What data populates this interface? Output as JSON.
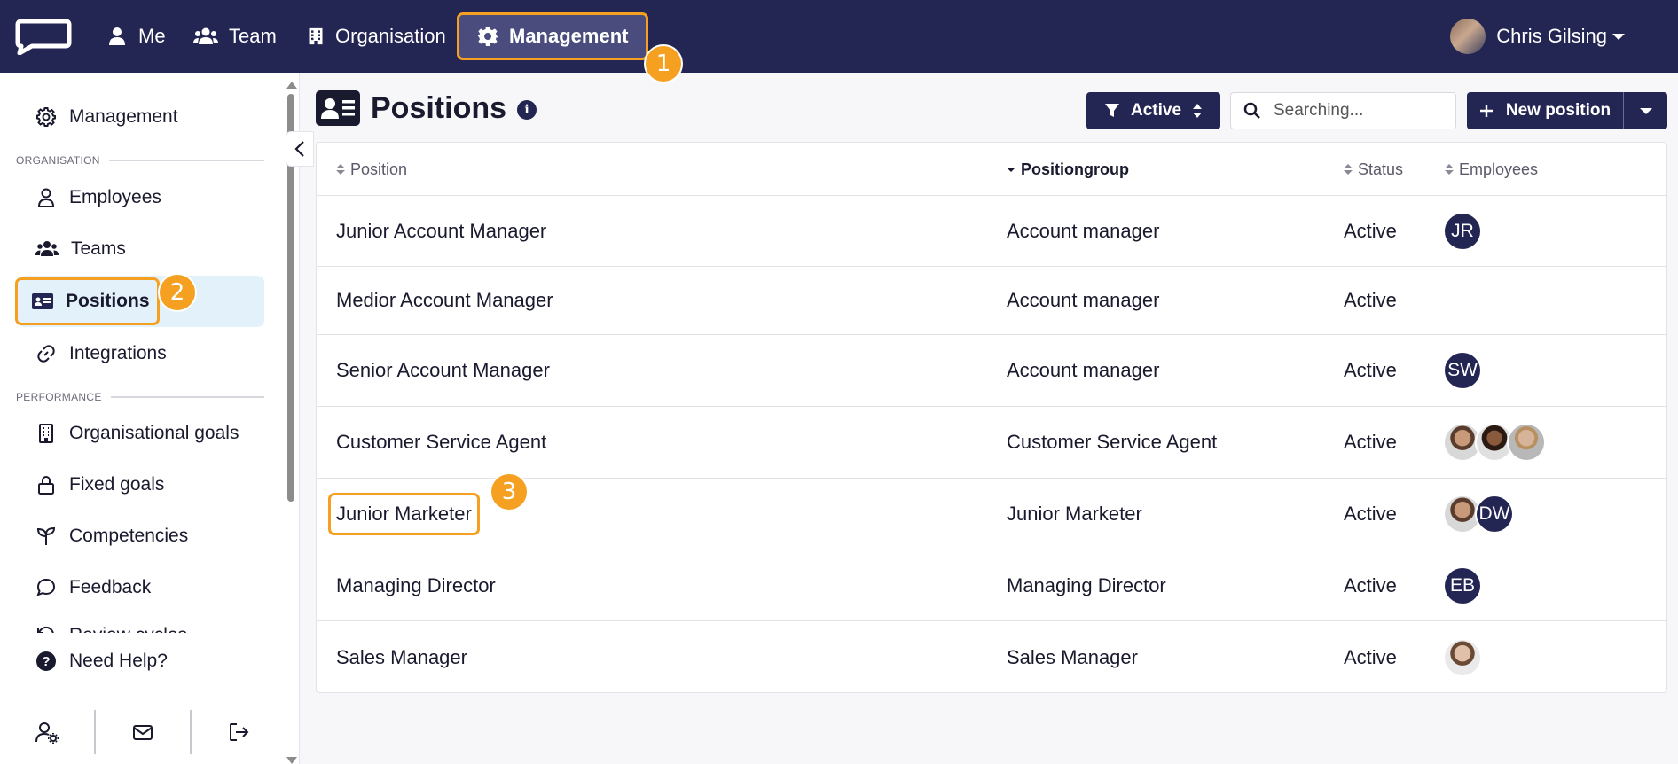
{
  "topnav": {
    "items": [
      {
        "label": "Me",
        "icon": "user-icon"
      },
      {
        "label": "Team",
        "icon": "users-icon"
      },
      {
        "label": "Organisation",
        "icon": "building-icon"
      },
      {
        "label": "Management",
        "icon": "gear-icon"
      }
    ],
    "user_name": "Chris Gilsing"
  },
  "badges": [
    "1",
    "2",
    "3"
  ],
  "sidebar": {
    "management_label": "Management",
    "section_organisation": "ORGANISATION",
    "section_performance": "PERFORMANCE",
    "items": [
      {
        "label": "Employees",
        "icon": "user-icon"
      },
      {
        "label": "Teams",
        "icon": "users-icon"
      },
      {
        "label": "Positions",
        "icon": "id-card-icon"
      },
      {
        "label": "Integrations",
        "icon": "link-icon"
      },
      {
        "label": "Organisational goals",
        "icon": "building-icon"
      },
      {
        "label": "Fixed goals",
        "icon": "lock-icon"
      },
      {
        "label": "Competencies",
        "icon": "sprout-icon"
      },
      {
        "label": "Feedback",
        "icon": "chat-icon"
      },
      {
        "label": "Review cycles",
        "icon": "refresh-icon"
      }
    ],
    "help_label": "Need Help?"
  },
  "page": {
    "title": "Positions",
    "filter_label": "Active",
    "search_placeholder": "Searching...",
    "new_button_label": "New position"
  },
  "table": {
    "columns": [
      "Position",
      "Positiongroup",
      "Status",
      "Employees"
    ],
    "sorted_column": "Positiongroup",
    "rows": [
      {
        "position": "Junior Account Manager",
        "group": "Account manager",
        "status": "Active",
        "employees": [
          {
            "type": "initials",
            "text": "JR"
          }
        ]
      },
      {
        "position": "Medior Account Manager",
        "group": "Account manager",
        "status": "Active",
        "employees": []
      },
      {
        "position": "Senior Account Manager",
        "group": "Account manager",
        "status": "Active",
        "employees": [
          {
            "type": "initials",
            "text": "SW"
          }
        ]
      },
      {
        "position": "Customer Service Agent",
        "group": "Customer Service Agent",
        "status": "Active",
        "employees": [
          {
            "type": "photo",
            "style": "p1"
          },
          {
            "type": "photo",
            "style": "p2"
          },
          {
            "type": "photo",
            "style": "p3"
          }
        ]
      },
      {
        "position": "Junior Marketer",
        "group": "Junior Marketer",
        "status": "Active",
        "employees": [
          {
            "type": "photo",
            "style": "p1"
          },
          {
            "type": "initials",
            "text": "DW"
          }
        ]
      },
      {
        "position": "Managing Director",
        "group": "Managing Director",
        "status": "Active",
        "employees": [
          {
            "type": "initials",
            "text": "EB"
          }
        ]
      },
      {
        "position": "Sales Manager",
        "group": "Sales Manager",
        "status": "Active",
        "employees": [
          {
            "type": "photo",
            "style": "p4"
          }
        ]
      }
    ]
  },
  "colors": {
    "navy": "#232553",
    "highlight": "#f5a021",
    "active_bg": "#e3f1fb"
  }
}
